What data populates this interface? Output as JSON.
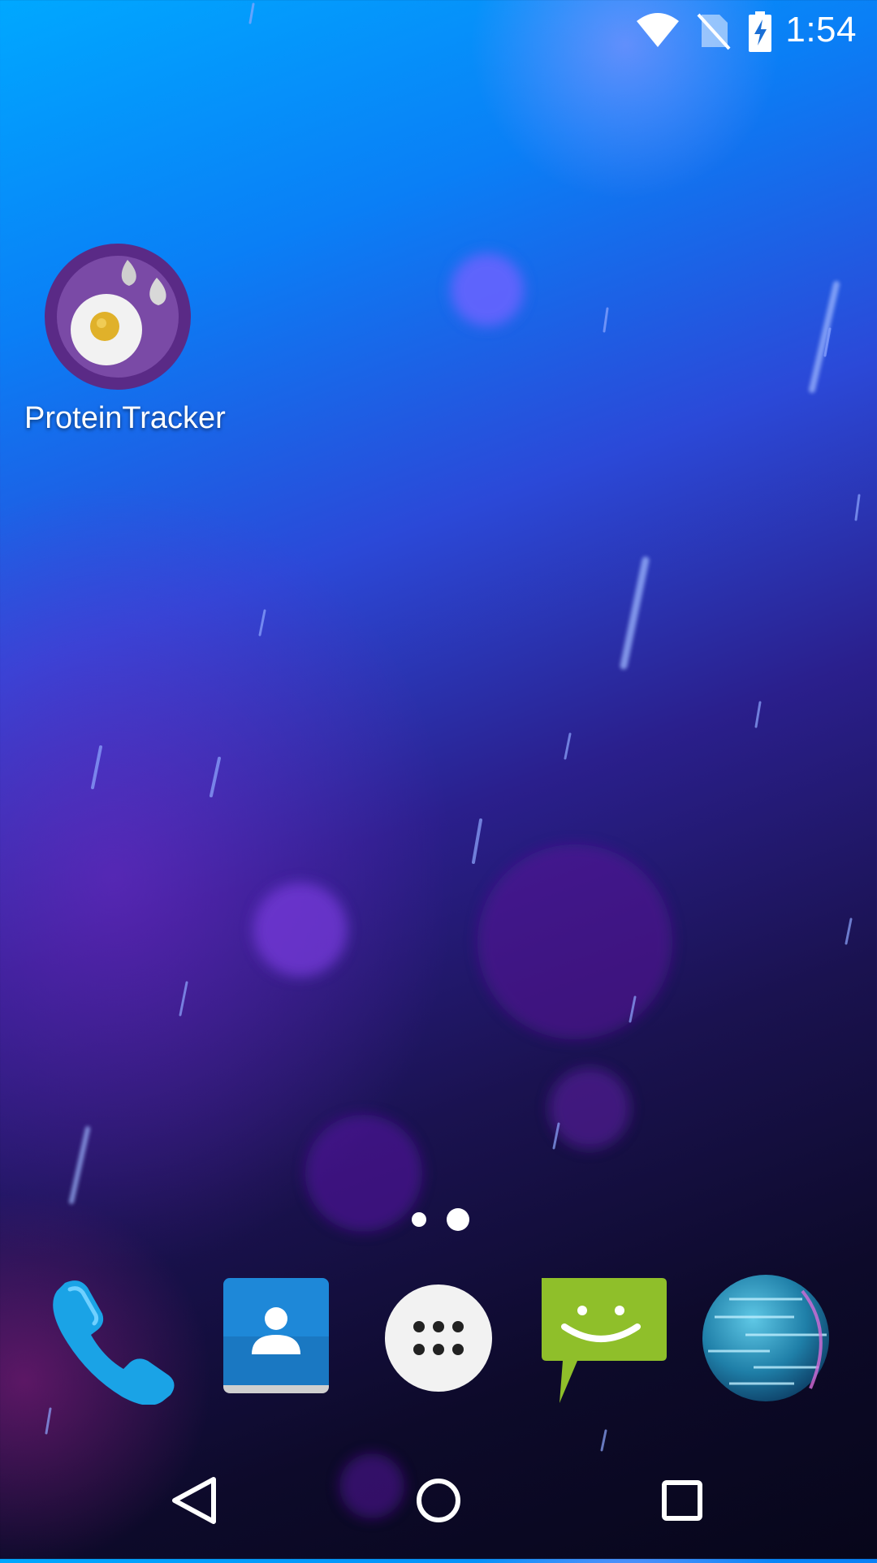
{
  "status_bar": {
    "time": "1:54",
    "icons": [
      "wifi-icon",
      "no-sim-icon",
      "battery-charging-icon"
    ]
  },
  "home": {
    "apps": [
      {
        "label": "ProteinTracker",
        "icon": "protein-tracker-egg-icon"
      }
    ]
  },
  "page_indicator": {
    "pages": 2,
    "current": 2
  },
  "dock": {
    "items": [
      {
        "name": "Phone",
        "icon": "phone-icon"
      },
      {
        "name": "Contacts",
        "icon": "contacts-icon"
      },
      {
        "name": "All apps",
        "icon": "app-drawer-icon"
      },
      {
        "name": "Messaging",
        "icon": "messaging-icon"
      },
      {
        "name": "Browser",
        "icon": "globe-icon"
      }
    ]
  },
  "nav_bar": {
    "buttons": [
      "back-icon",
      "home-icon",
      "recents-icon"
    ]
  },
  "colors": {
    "app_icon_purple": "#5a2a86",
    "egg_yolk": "#e0b12a",
    "messaging_green": "#8fbf2a",
    "phone_blue": "#1aa3e6",
    "contacts_blue": "#1e88d8"
  }
}
